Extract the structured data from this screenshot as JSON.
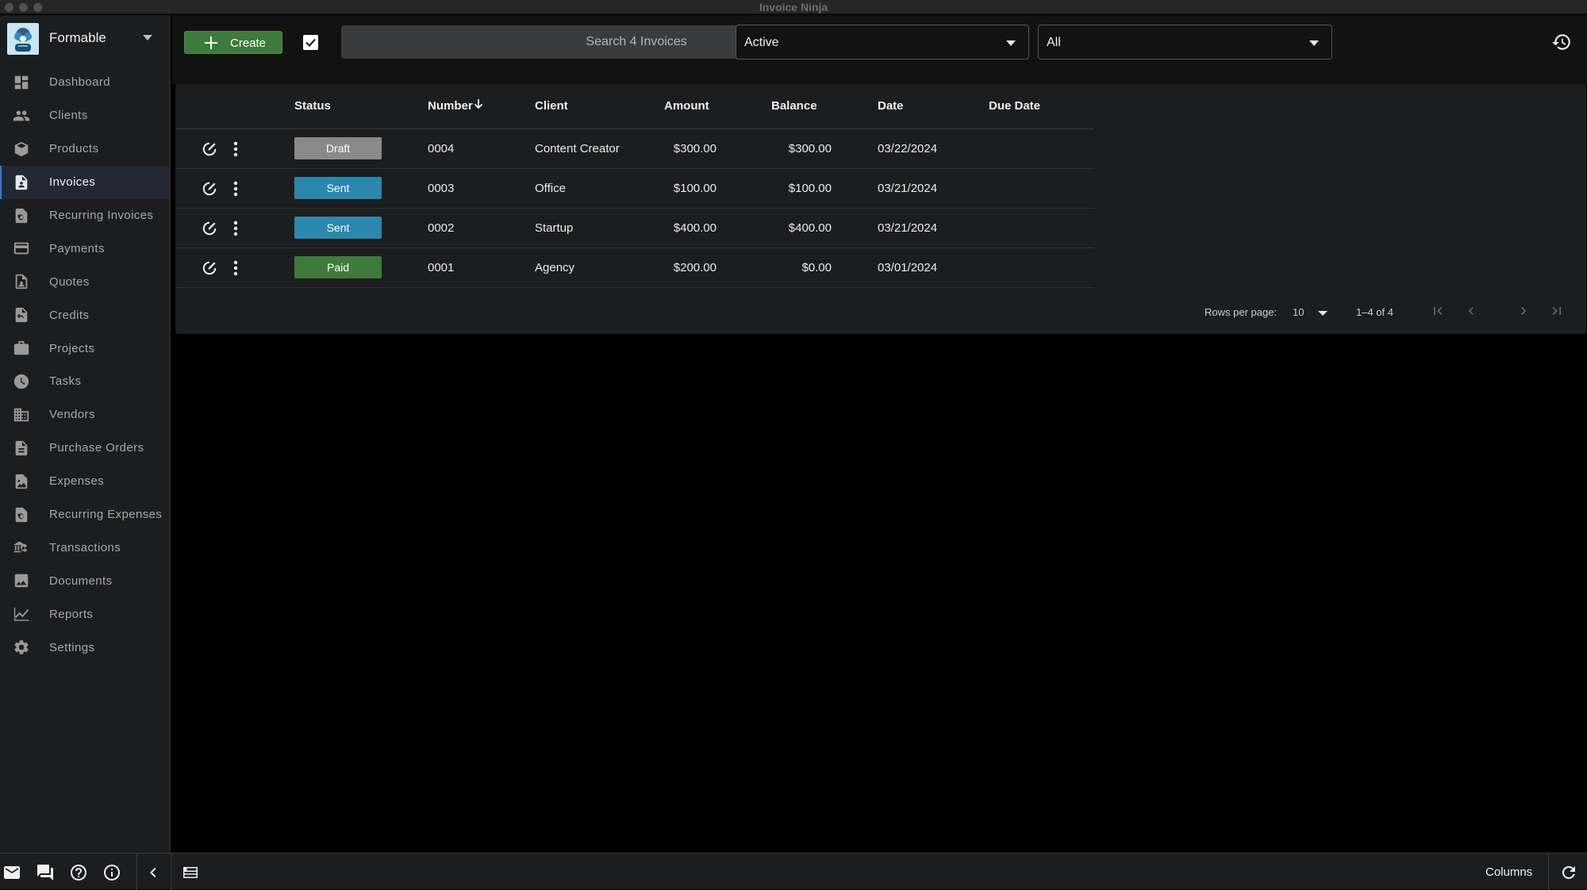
{
  "window": {
    "title": "Invoice Ninja"
  },
  "company": {
    "name": "Formable"
  },
  "sidebar": {
    "items": [
      {
        "label": "Dashboard",
        "icon": "dashboard-icon",
        "active": false
      },
      {
        "label": "Clients",
        "icon": "people-icon",
        "active": false
      },
      {
        "label": "Products",
        "icon": "cube-icon",
        "active": false
      },
      {
        "label": "Invoices",
        "icon": "invoice-icon",
        "active": true
      },
      {
        "label": "Recurring Invoices",
        "icon": "recurring-invoice-icon",
        "active": false
      },
      {
        "label": "Payments",
        "icon": "credit-card-icon",
        "active": false
      },
      {
        "label": "Quotes",
        "icon": "quote-icon",
        "active": false
      },
      {
        "label": "Credits",
        "icon": "credit-icon",
        "active": false
      },
      {
        "label": "Projects",
        "icon": "briefcase-icon",
        "active": false
      },
      {
        "label": "Tasks",
        "icon": "clock-icon",
        "active": false
      },
      {
        "label": "Vendors",
        "icon": "building-icon",
        "active": false
      },
      {
        "label": "Purchase Orders",
        "icon": "document-icon",
        "active": false
      },
      {
        "label": "Expenses",
        "icon": "receipt-image-icon",
        "active": false
      },
      {
        "label": "Recurring Expenses",
        "icon": "recurring-expense-icon",
        "active": false
      },
      {
        "label": "Transactions",
        "icon": "bank-transfer-icon",
        "active": false
      },
      {
        "label": "Documents",
        "icon": "image-icon",
        "active": false
      },
      {
        "label": "Reports",
        "icon": "chart-line-icon",
        "active": false
      },
      {
        "label": "Settings",
        "icon": "gear-icon",
        "active": false
      }
    ]
  },
  "toolbar": {
    "create_label": "Create",
    "search_placeholder": "Search 4 Invoices",
    "status_filter": "Active",
    "secondary_filter": "All"
  },
  "table": {
    "columns": [
      "Status",
      "Number",
      "Client",
      "Amount",
      "Balance",
      "Date",
      "Due Date"
    ],
    "sort_column": "Number",
    "sort_direction": "descending",
    "rows": [
      {
        "status": "Draft",
        "status_color": "#8a8a8a",
        "number": "0004",
        "client": "Content Creator",
        "amount": "$300.00",
        "balance": "$300.00",
        "date": "03/22/2024",
        "due_date": ""
      },
      {
        "status": "Sent",
        "status_color": "#2b87ad",
        "number": "0003",
        "client": "Office",
        "amount": "$100.00",
        "balance": "$100.00",
        "date": "03/21/2024",
        "due_date": ""
      },
      {
        "status": "Sent",
        "status_color": "#2b87ad",
        "number": "0002",
        "client": "Startup",
        "amount": "$400.00",
        "balance": "$400.00",
        "date": "03/21/2024",
        "due_date": ""
      },
      {
        "status": "Paid",
        "status_color": "#3f7a3a",
        "number": "0001",
        "client": "Agency",
        "amount": "$200.00",
        "balance": "$0.00",
        "date": "03/01/2024",
        "due_date": ""
      }
    ]
  },
  "pagination": {
    "rows_per_page_label": "Rows per page:",
    "rows_per_page": "10",
    "range": "1–4 of 4"
  },
  "bottombar": {
    "columns_label": "Columns"
  }
}
